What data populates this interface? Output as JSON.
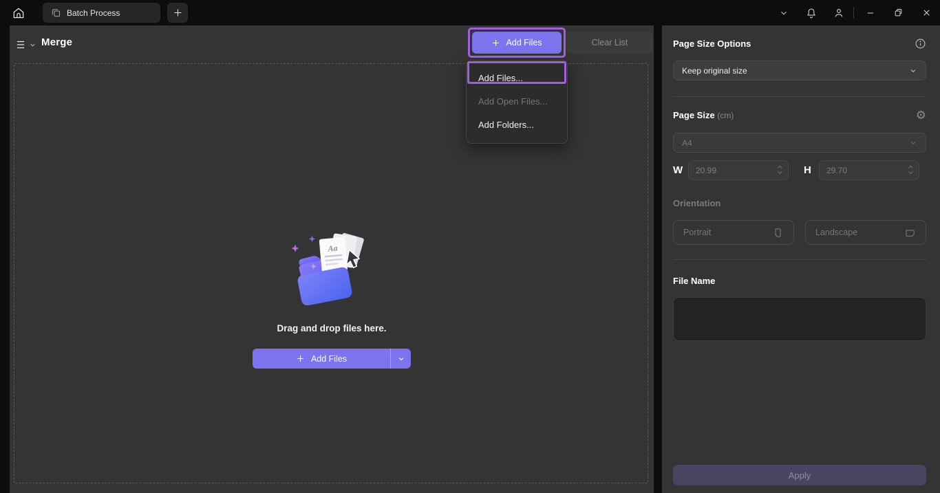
{
  "titlebar": {
    "tab_title": "Batch Process"
  },
  "toolbar": {
    "title": "Merge",
    "add_files_label": "Add Files",
    "clear_list_label": "Clear List"
  },
  "add_menu": {
    "items": [
      {
        "label": "Add Files...",
        "disabled": false,
        "highlighted": true
      },
      {
        "label": "Add Open Files...",
        "disabled": true,
        "highlighted": false
      },
      {
        "label": "Add Folders...",
        "disabled": false,
        "highlighted": false
      }
    ]
  },
  "dropzone": {
    "hint": "Drag and drop files here.",
    "add_files_label": "Add Files"
  },
  "side_panel": {
    "page_size_options": {
      "title": "Page Size Options",
      "selected": "Keep original size"
    },
    "page_size": {
      "title": "Page Size",
      "unit": "(cm)",
      "preset": "A4",
      "w_label": "W",
      "w_value": "20.99",
      "h_label": "H",
      "h_value": "29.70"
    },
    "orientation": {
      "title": "Orientation",
      "portrait_label": "Portrait",
      "landscape_label": "Landscape"
    },
    "file_name": {
      "title": "File Name",
      "value": ""
    },
    "apply_label": "Apply"
  },
  "icons": {
    "home": "home-icon",
    "batch": "batch-icon",
    "new_tab": "plus-icon",
    "notifications": "bell-icon",
    "account": "person-icon",
    "minimize": "minimize-icon",
    "restore": "restore-icon",
    "close": "close-icon",
    "menu": "hamburger-icon",
    "info": "info-icon",
    "settings": "gear-icon ⚙",
    "chevron": "chevron-down-icon"
  },
  "colors": {
    "accent": "#7b74ee",
    "highlight": "#a15fe0",
    "panel_bg": "#343434",
    "titlebar_bg": "#0d0d0d",
    "menu_bg": "#2c2c2c",
    "apply_disabled_bg": "#474560",
    "disabled_text": "#787878"
  }
}
